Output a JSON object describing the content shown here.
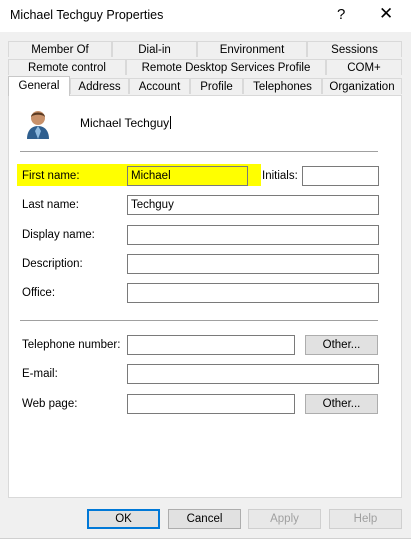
{
  "window": {
    "title": "Michael Techguy Properties",
    "help_glyph": "?",
    "close_glyph": "✕"
  },
  "tabs": {
    "row1": [
      "Member Of",
      "Dial-in",
      "Environment",
      "Sessions"
    ],
    "row2": [
      "Remote control",
      "Remote Desktop Services Profile",
      "COM+"
    ],
    "row3": [
      "General",
      "Address",
      "Account",
      "Profile",
      "Telephones",
      "Organization"
    ],
    "selected": "General"
  },
  "general": {
    "display_user": "Michael Techguy",
    "avatar_icon": "user-icon",
    "highlight_color": "#ffff00",
    "fields": {
      "first_name": {
        "label": "First name:",
        "value": "Michael"
      },
      "initials": {
        "label": "Initials:",
        "value": ""
      },
      "last_name": {
        "label": "Last name:",
        "value": "Techguy"
      },
      "display_name": {
        "label": "Display name:",
        "value": ""
      },
      "description": {
        "label": "Description:",
        "value": ""
      },
      "office": {
        "label": "Office:",
        "value": ""
      },
      "telephone": {
        "label": "Telephone number:",
        "value": ""
      },
      "email": {
        "label": "E-mail:",
        "value": ""
      },
      "web_page": {
        "label": "Web page:",
        "value": ""
      }
    },
    "other_label": "Other..."
  },
  "buttons": {
    "ok": "OK",
    "cancel": "Cancel",
    "apply": "Apply",
    "help": "Help"
  }
}
